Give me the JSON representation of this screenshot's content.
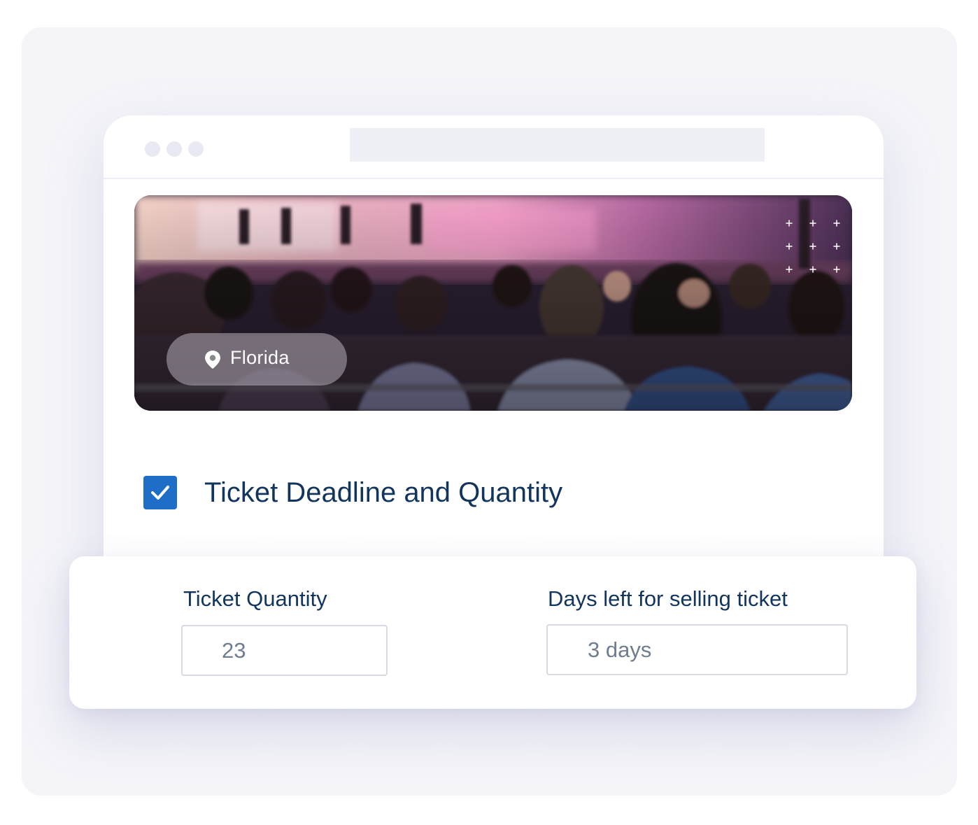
{
  "hero": {
    "location": "Florida",
    "location_icon": "map-pin-icon",
    "decoration": "plus-sparkle-icon"
  },
  "section": {
    "checked": true,
    "title": "Ticket Deadline and Quantity"
  },
  "form": {
    "quantity_label": "Ticket Quantity",
    "quantity_value": "23",
    "days_label": "Days left for selling ticket",
    "days_value": "3 days"
  },
  "colors": {
    "accent": "#1e6ec8",
    "heading": "#12355e",
    "muted_value": "#6e7d8f"
  }
}
